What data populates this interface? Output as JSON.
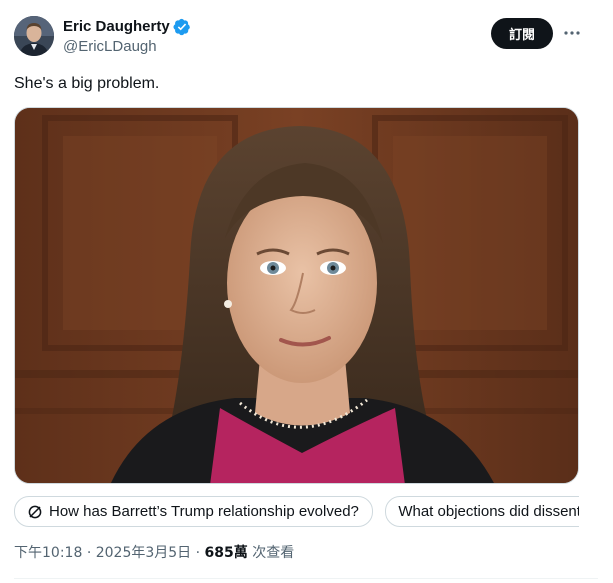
{
  "author": {
    "display_name": "Eric Daugherty",
    "handle": "@EricLDaugh",
    "verified": true
  },
  "header": {
    "subscribe_label": "訂閱",
    "more_icon": "more-horizontal-icon"
  },
  "tweet": {
    "text": "She's a big problem."
  },
  "suggestions": [
    {
      "label": "How has Barrett’s Trump relationship evolved?",
      "icon": "grok-icon"
    },
    {
      "label": "What objections did dissenters raise?"
    }
  ],
  "meta": {
    "time": "下午10:18",
    "separator1": "·",
    "date": "2025年3月5日",
    "separator2": "·",
    "views_count": "685萬",
    "views_label": "次查看"
  },
  "colors": {
    "text_primary": "#0f1419",
    "text_secondary": "#536471",
    "verified_blue": "#1d9bf0",
    "border": "#cfd9de",
    "button_dark": "#0f1419"
  }
}
